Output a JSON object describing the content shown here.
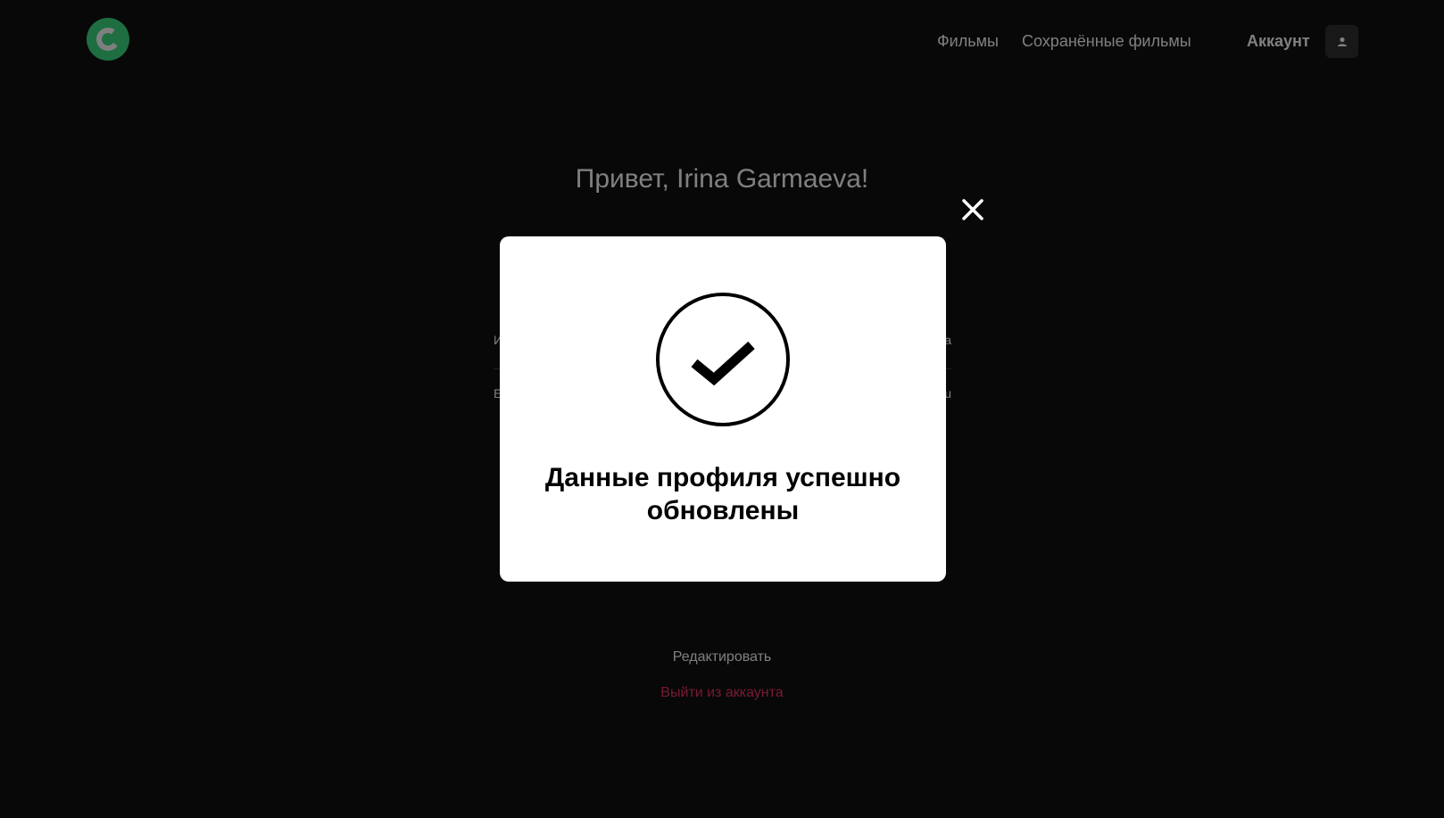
{
  "header": {
    "nav": {
      "films_label": "Фильмы",
      "saved_films_label": "Сохранённые фильмы"
    },
    "account_label": "Аккаунт",
    "account_icon": "user-icon",
    "logo_icon": "logo-icon"
  },
  "profile": {
    "greeting": "Привет, Irina Garmaeva!",
    "name_label": "И",
    "name_value": "а",
    "email_label": "E",
    "email_value": "u",
    "edit_label": "Редактировать",
    "logout_label": "Выйти из аккаунта"
  },
  "modal": {
    "message": "Данные профиля успешно обновлены",
    "icon": "checkmark-circle-icon",
    "close_icon": "close-icon"
  },
  "colors": {
    "background": "#111111",
    "accent": "#3DDC84",
    "logout": "#EE3465",
    "modal_bg": "#FFFFFF"
  }
}
